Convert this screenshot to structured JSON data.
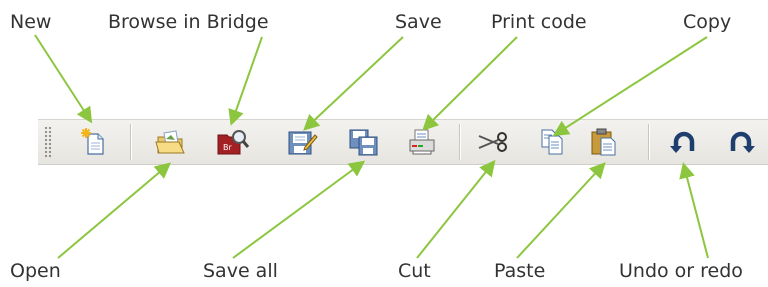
{
  "callouts": {
    "new": "New",
    "browse_in_bridge": "Browse in Bridge",
    "save": "Save",
    "print_code": "Print code",
    "copy": "Copy",
    "open": "Open",
    "save_all": "Save all",
    "cut": "Cut",
    "paste": "Paste",
    "undo_or_redo": "Undo or redo"
  },
  "bridge_icon_text": "Br",
  "colors": {
    "leader_line": "#8cc63f",
    "label_text": "#333333",
    "toolbar_bg": "#ebe9e4"
  },
  "icons": [
    "new-document-icon",
    "open-folder-icon",
    "browse-bridge-icon",
    "save-icon",
    "save-all-icon",
    "print-icon",
    "cut-icon",
    "copy-icon",
    "paste-icon",
    "undo-icon",
    "redo-icon"
  ]
}
